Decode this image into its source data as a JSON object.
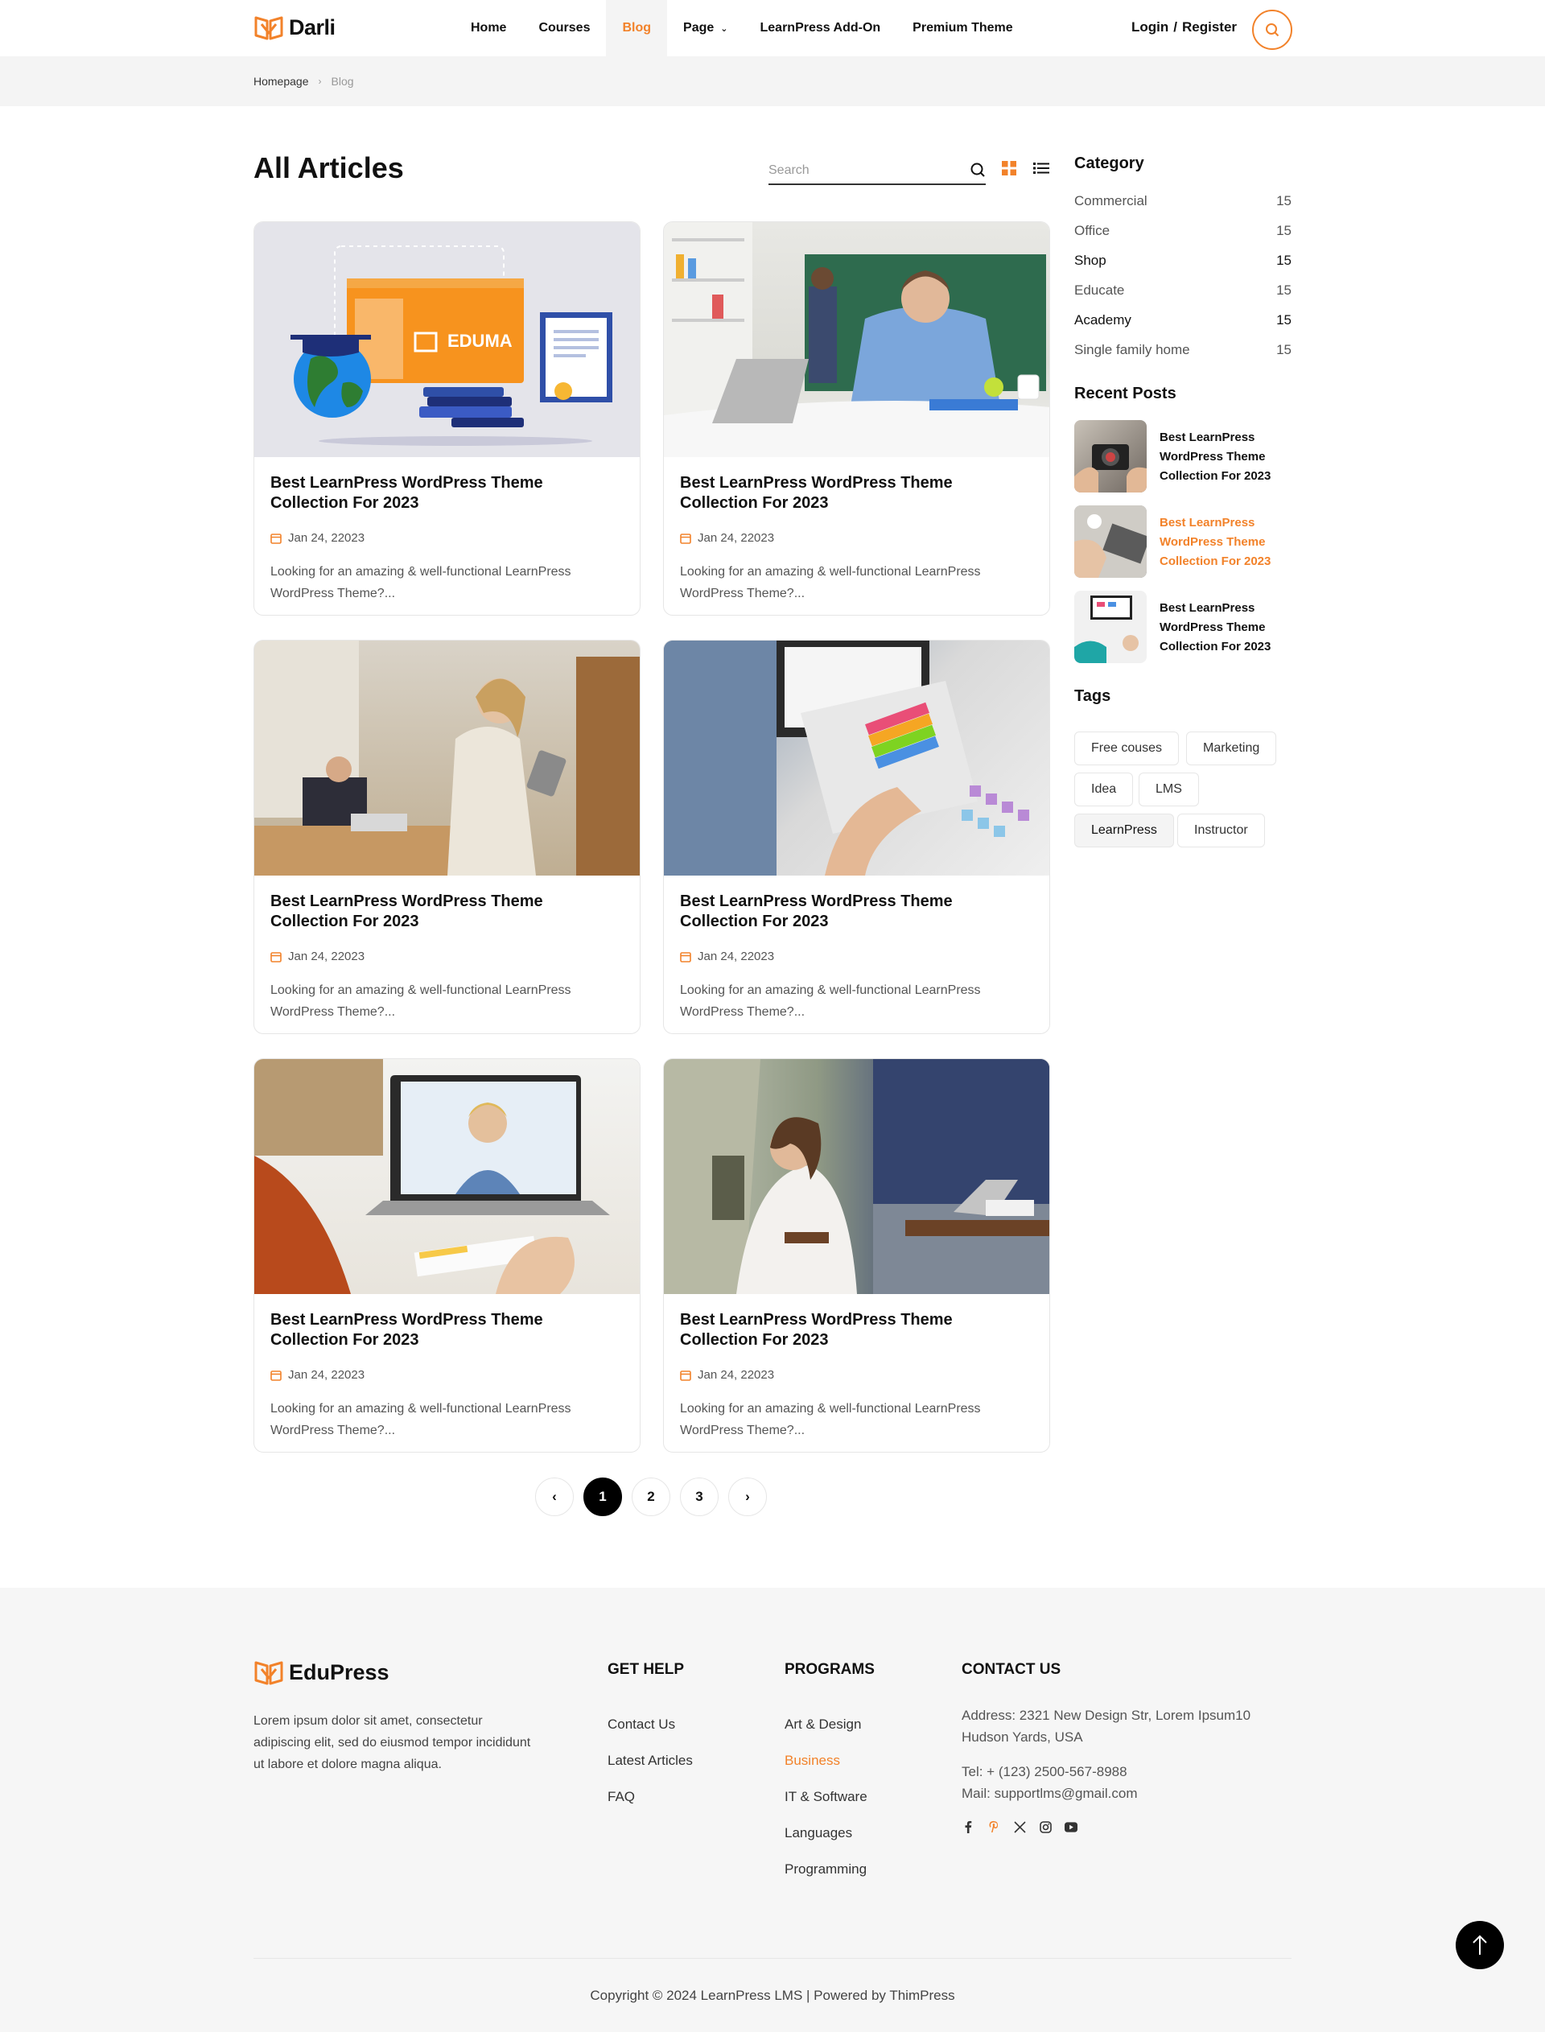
{
  "header": {
    "brand": "Darli",
    "nav": [
      {
        "label": "Home"
      },
      {
        "label": "Courses"
      },
      {
        "label": "Blog"
      },
      {
        "label": "Page"
      },
      {
        "label": "LearnPress Add-On"
      },
      {
        "label": "Premium Theme"
      }
    ],
    "login": "Login",
    "register": "Register",
    "slash": "/",
    "accent": "#f2822a"
  },
  "breadcrumb": {
    "home": "Homepage",
    "current": "Blog"
  },
  "main": {
    "title": "All Articles",
    "search_placeholder": "Search",
    "cards": [
      {
        "title": "Best LearnPress WordPress Theme Collection For 2023",
        "date": "Jan 24, 22023",
        "excerpt": "Looking for an amazing & well-functional LearnPress WordPress Theme?...",
        "badge": "EDUMA"
      },
      {
        "title": "Best LearnPress WordPress Theme Collection For 2023",
        "date": "Jan 24, 22023",
        "excerpt": "Looking for an amazing & well-functional LearnPress WordPress Theme?..."
      },
      {
        "title": "Best LearnPress WordPress Theme Collection For 2023",
        "date": "Jan 24, 22023",
        "excerpt": "Looking for an amazing & well-functional LearnPress WordPress Theme?..."
      },
      {
        "title": "Best LearnPress WordPress Theme Collection For 2023",
        "date": "Jan 24, 22023",
        "excerpt": "Looking for an amazing & well-functional LearnPress WordPress Theme?..."
      },
      {
        "title": "Best LearnPress WordPress Theme Collection For 2023",
        "date": "Jan 24, 22023",
        "excerpt": "Looking for an amazing & well-functional LearnPress WordPress Theme?..."
      },
      {
        "title": "Best LearnPress WordPress Theme Collection For 2023",
        "date": "Jan 24, 22023",
        "excerpt": "Looking for an amazing & well-functional LearnPress WordPress Theme?..."
      }
    ],
    "pagination": {
      "pages": [
        "1",
        "2",
        "3"
      ],
      "current": "1"
    }
  },
  "sidebar": {
    "category_heading": "Category",
    "categories": [
      {
        "name": "Commercial",
        "count": "15"
      },
      {
        "name": "Office",
        "count": "15"
      },
      {
        "name": "Shop",
        "count": "15"
      },
      {
        "name": "Educate",
        "count": "15"
      },
      {
        "name": "Academy",
        "count": "15"
      },
      {
        "name": "Single family home",
        "count": "15"
      }
    ],
    "recent_heading": "Recent Posts",
    "recent": [
      {
        "title": "Best LearnPress WordPress Theme Collection For 2023"
      },
      {
        "title": "Best LearnPress WordPress Theme Collection For 2023"
      },
      {
        "title": "Best LearnPress WordPress Theme Collection For 2023"
      }
    ],
    "tags_heading": "Tags",
    "tags": [
      "Free couses",
      "Marketing",
      "Idea",
      "LMS",
      "LearnPress",
      "Instructor"
    ]
  },
  "footer": {
    "brand": "EduPress",
    "description": "Lorem ipsum dolor sit amet, consectetur adipiscing elit, sed do eiusmod tempor incididunt ut labore et dolore magna aliqua.",
    "help_heading": "GET HELP",
    "help_links": [
      "Contact Us",
      "Latest Articles",
      "FAQ"
    ],
    "programs_heading": "PROGRAMS",
    "programs_links": [
      "Art & Design",
      "Business",
      "IT & Software",
      "Languages",
      "Programming"
    ],
    "contact_heading": "CONTACT US",
    "address": "Address: 2321 New Design Str, Lorem Ipsum10 Hudson Yards, USA",
    "tel": "Tel: + (123) 2500-567-8988",
    "mail": "Mail: supportlms@gmail.com",
    "social": [
      "facebook-icon",
      "pinterest-icon",
      "x-icon",
      "instagram-icon",
      "youtube-icon"
    ],
    "copyright": "Copyright © 2024 LearnPress LMS | Powered by ThimPress"
  }
}
